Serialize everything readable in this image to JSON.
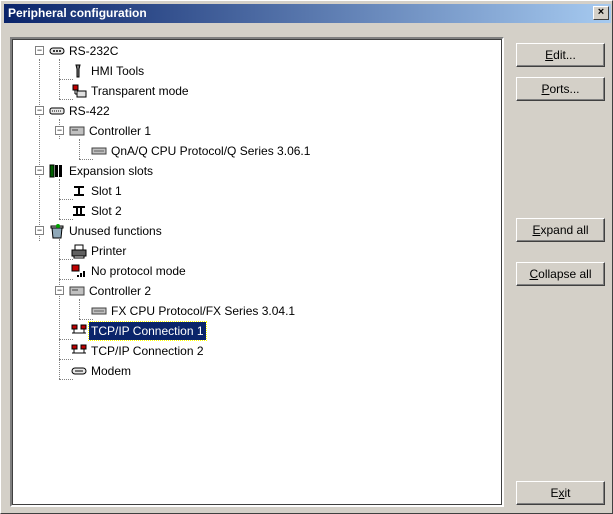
{
  "window": {
    "title": "Peripheral configuration",
    "close_glyph": "×"
  },
  "buttons": {
    "edit": {
      "acc": "E",
      "rest": "dit..."
    },
    "ports": {
      "acc": "P",
      "rest": "orts..."
    },
    "expand_all": {
      "acc": "E",
      "rest": "xpand all"
    },
    "collapse_all": {
      "acc": "C",
      "rest": "ollapse all"
    },
    "exit": {
      "pre": "E",
      "acc": "x",
      "rest": "it"
    }
  },
  "tree": {
    "rs232": {
      "label": "RS-232C",
      "expander": "−",
      "icon": "serial-port-icon"
    },
    "hmi": {
      "label": "HMI Tools",
      "icon": "tools-icon"
    },
    "transparent": {
      "label": "Transparent mode",
      "icon": "transparent-mode-icon"
    },
    "rs422": {
      "label": "RS-422",
      "expander": "−",
      "icon": "serial-port-icon"
    },
    "ctrl1": {
      "label": "Controller 1",
      "expander": "−",
      "icon": "controller-icon"
    },
    "qna": {
      "label": "QnA/Q CPU Protocol/Q Series 3.06.1",
      "icon": "protocol-icon"
    },
    "expansion": {
      "label": "Expansion slots",
      "expander": "−",
      "icon": "expansion-slots-icon"
    },
    "slot1": {
      "label": "Slot 1",
      "icon": "slot-icon"
    },
    "slot2": {
      "label": "Slot 2",
      "icon": "slot-icon"
    },
    "unused": {
      "label": "Unused functions",
      "expander": "−",
      "icon": "unused-functions-icon"
    },
    "printer": {
      "label": "Printer",
      "icon": "printer-icon"
    },
    "noproto": {
      "label": "No protocol mode",
      "icon": "no-protocol-icon"
    },
    "ctrl2": {
      "label": "Controller 2",
      "expander": "−",
      "icon": "controller-icon"
    },
    "fx": {
      "label": "FX CPU Protocol/FX Series 3.04.1",
      "icon": "protocol-icon"
    },
    "tcp1": {
      "label": "TCP/IP Connection 1",
      "icon": "network-icon",
      "selected": true
    },
    "tcp2": {
      "label": "TCP/IP Connection 2",
      "icon": "network-icon"
    },
    "modem": {
      "label": "Modem",
      "icon": "modem-icon"
    }
  }
}
